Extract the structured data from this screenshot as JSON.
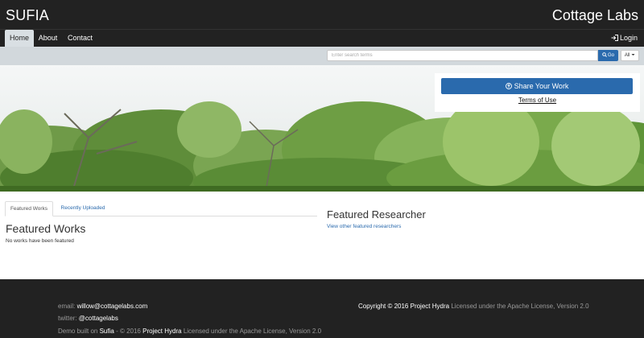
{
  "header": {
    "brand": "SUFIA",
    "organization": "Cottage Labs"
  },
  "nav": {
    "items": [
      {
        "label": "Home",
        "active": true
      },
      {
        "label": "About",
        "active": false
      },
      {
        "label": "Contact",
        "active": false
      }
    ],
    "login_label": "Login"
  },
  "search": {
    "placeholder": "Enter search terms",
    "value": "",
    "go_label": "Go",
    "scope_label": "All"
  },
  "hero": {
    "share_label": "Share Your Work",
    "terms_label": "Terms of Use"
  },
  "tabs": [
    {
      "label": "Featured Works",
      "active": true
    },
    {
      "label": "Recently Uploaded",
      "active": false
    }
  ],
  "featured_works": {
    "title": "Featured Works",
    "empty_message": "No works have been featured"
  },
  "featured_researcher": {
    "title": "Featured Researcher",
    "link_label": "View other featured researchers"
  },
  "footer": {
    "email_label": "email:",
    "email_value": "willow@cottagelabs.com",
    "twitter_label": "twitter:",
    "twitter_value": "@cottagelabs",
    "demo_prefix": "Demo built on",
    "demo_project": "Sufia",
    "demo_middle": "- © 2016",
    "demo_org": "Project Hydra",
    "demo_suffix": "Licensed under the Apache License, Version 2.0",
    "copyright_prefix": "Copyright © 2016",
    "copyright_org": "Project Hydra",
    "copyright_suffix": "Licensed under the Apache License, Version 2.0"
  },
  "colors": {
    "topbar": "#222222",
    "primary": "#2a6aad",
    "searchbar": "#d2d8dc",
    "footer": "#222222"
  }
}
